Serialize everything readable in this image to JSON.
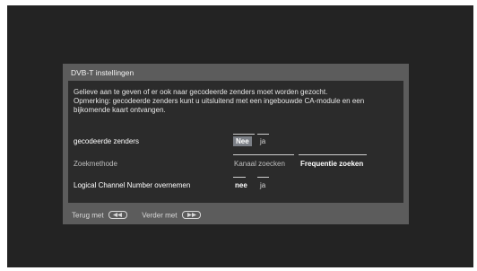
{
  "dialog": {
    "title": "DVB-T  instellingen",
    "info_lines": [
      "Gelieve aan te geven of er ook naar gecodeerde zenders moet worden gezocht.",
      "Opmerking: gecodeerde zenders kunt u uitsluitend met een ingebouwde CA-module en een",
      "bijkomende kaart ontvangen."
    ],
    "rows": [
      {
        "label": "gecodeerde zenders",
        "options": [
          "Nee",
          "ja"
        ],
        "selected": "Nee"
      },
      {
        "label": "Zoekmethode",
        "options": [
          "Kanaal zoecken",
          "Frequentie zoeken"
        ],
        "selected": "Frequentie zoeken"
      },
      {
        "label": "Logical Channel Number overnemen",
        "options": [
          "nee",
          "ja"
        ],
        "selected": "nee"
      }
    ],
    "footer": {
      "back_label": "Terug met",
      "back_icon": "rewind-button-icon",
      "next_label": "Verder met",
      "next_icon": "fast-forward-button-icon"
    }
  }
}
